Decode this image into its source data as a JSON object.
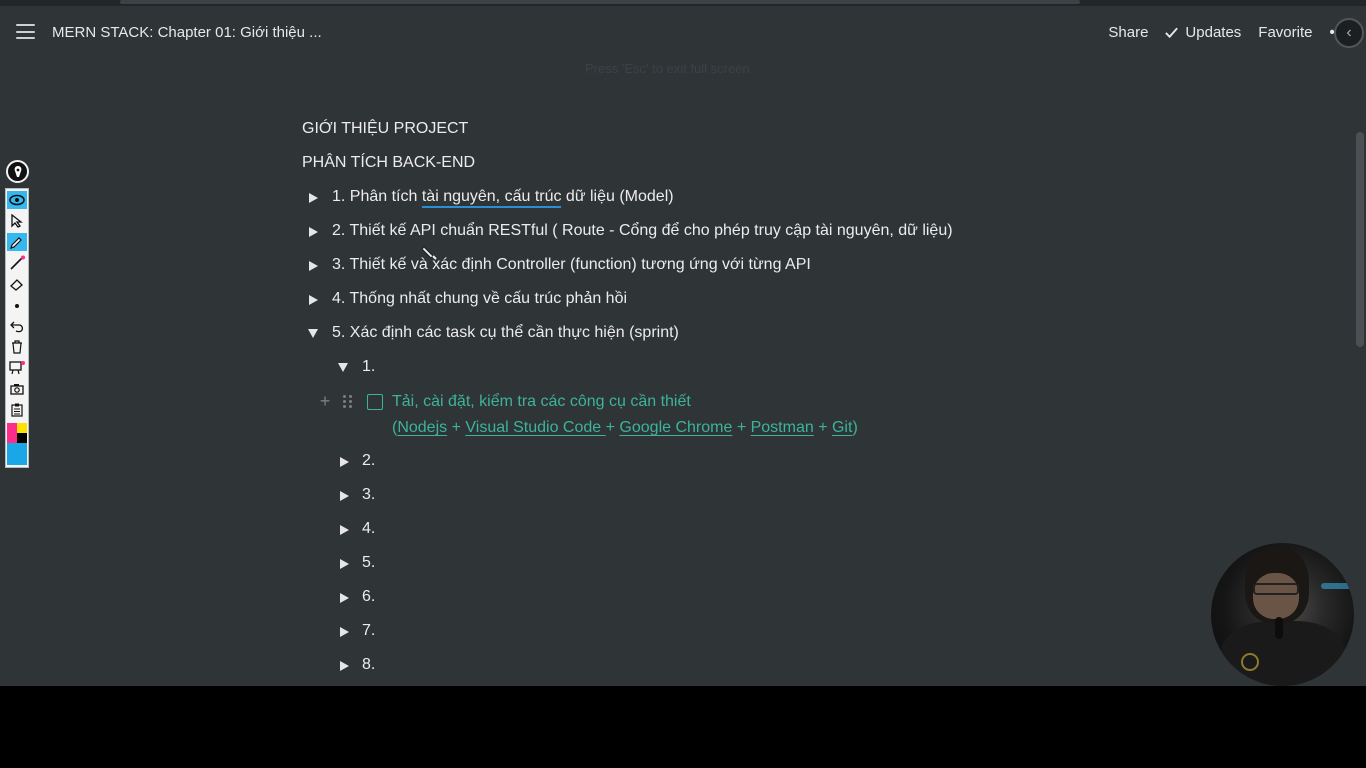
{
  "header": {
    "title": "MERN STACK: Chapter 01: Giới thiệu ...",
    "share_label": "Share",
    "updates_label": "Updates",
    "favorite_label": "Favorite",
    "more_label": "••",
    "menu_icon": "hamburger-menu-icon",
    "check_icon": "check-icon",
    "back_icon": "chevron-left-icon"
  },
  "ghost_text": "Press 'Esc' to exit full screen",
  "sections": {
    "intro": "GIỚI THIỆU PROJECT",
    "backend": "PHÂN TÍCH BACK-END"
  },
  "toggles": [
    {
      "label_before": "1. Phân tích ",
      "label_underlined": "tài nguyên, cấu trúc",
      "label_after": " dữ liệu (Model)",
      "state": "collapsed"
    },
    {
      "label": "2. Thiết kế API chuẩn RESTful ( Route - Cổng để cho phép truy cập tài nguyên, dữ liệu)",
      "state": "collapsed"
    },
    {
      "label": "3. Thiết kế và xác định Controller (function) tương ứng với từng API",
      "state": "collapsed"
    },
    {
      "label": "4. Thống nhất chung về cấu trúc phản hồi",
      "state": "collapsed"
    },
    {
      "label": "5. Xác định các task cụ thể cần thực hiện (sprint)",
      "state": "expanded"
    }
  ],
  "sprints": [
    {
      "label": "1.",
      "state": "expanded"
    },
    {
      "label": "2.",
      "state": "collapsed"
    },
    {
      "label": "3.",
      "state": "collapsed"
    },
    {
      "label": "4.",
      "state": "collapsed"
    },
    {
      "label": "5.",
      "state": "collapsed"
    },
    {
      "label": "6.",
      "state": "collapsed"
    },
    {
      "label": "7.",
      "state": "collapsed"
    },
    {
      "label": "8.",
      "state": "collapsed"
    }
  ],
  "todo": {
    "text": "Tải, cài đặt, kiểm tra các công cụ cần thiết",
    "checked": false,
    "open_paren": "(",
    "close_paren": ")",
    "separator": " + ",
    "links": [
      "Nodejs",
      "Visual Studio Code ",
      "Google Chrome",
      "Postman",
      "Git"
    ]
  },
  "annotation_tools": [
    "eye-icon",
    "arrow-cursor-icon",
    "pen-icon",
    "line-icon",
    "eraser-icon",
    "dot-icon",
    "undo-icon",
    "trash-icon",
    "whiteboard-icon",
    "camera-icon",
    "clipboard-icon",
    "color-palette-icon"
  ],
  "colors": {
    "page_bg": "#2f3437",
    "todo_green": "#3db39b",
    "link_underline_blue": "#2b8fd6",
    "tool_active": "#35b7f0",
    "palette": [
      "#ff2d8a",
      "#ffe100",
      "#ff2d8a",
      "#000000",
      "#1aa7e8"
    ]
  }
}
